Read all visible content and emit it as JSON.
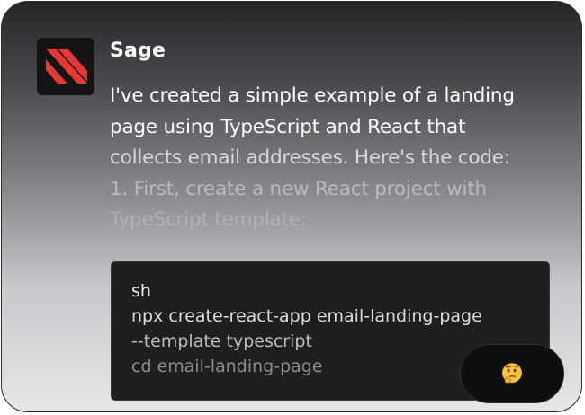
{
  "chat": {
    "sender": {
      "name": "Sage",
      "avatar_icon": "sage-logo-icon",
      "avatar_colors": {
        "background": "#141414",
        "stripes": "#e53935"
      }
    },
    "message": {
      "lines": [
        "I've created a simple example of a landing",
        "page using TypeScript and React that",
        "collects email addresses. Here's the code:",
        "1. First, create a new React project with",
        "TypeScript template:"
      ]
    },
    "code_block": {
      "lines": [
        "sh",
        "npx create-react-app email-landing-page",
        "--template typescript",
        "cd email-landing-page"
      ]
    },
    "reaction": {
      "icon": "thinking-face-icon"
    }
  }
}
